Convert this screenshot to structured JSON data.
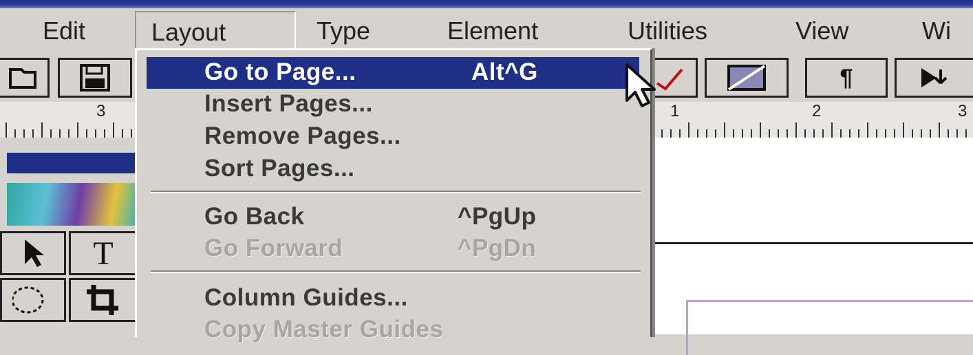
{
  "menubar": {
    "items": [
      "Edit",
      "Layout",
      "Type",
      "Element",
      "Utilities",
      "View",
      "Wi"
    ]
  },
  "toolbar": {
    "icons": [
      "open-icon",
      "save-icon",
      "spelling-icon",
      "fill-icon",
      "paragraph-icon",
      "play-icon"
    ],
    "paragraph_glyph": "¶"
  },
  "ruler": {
    "left_label": "3",
    "right_labels": [
      "1",
      "2",
      "3"
    ]
  },
  "toolbox": {
    "text_tool_glyph": "T",
    "icons": [
      "pointer-icon",
      "text-tool-icon",
      "ellipse-tool-icon",
      "crop-tool-icon"
    ]
  },
  "layout_menu": {
    "items": [
      {
        "label": "Go to Page...",
        "shortcut": "Alt^G",
        "state": "highlighted"
      },
      {
        "label": "Insert Pages...",
        "shortcut": "",
        "state": "normal"
      },
      {
        "label": "Remove Pages...",
        "shortcut": "",
        "state": "normal"
      },
      {
        "label": "Sort Pages...",
        "shortcut": "",
        "state": "normal"
      },
      {
        "label": "Go Back",
        "shortcut": "^PgUp",
        "state": "normal"
      },
      {
        "label": "Go Forward",
        "shortcut": "^PgDn",
        "state": "disabled"
      },
      {
        "label": "Column Guides...",
        "shortcut": "",
        "state": "normal"
      },
      {
        "label": "Copy Master Guides",
        "shortcut": "",
        "state": "disabled"
      }
    ]
  },
  "colors": {
    "highlight": "#1f2f86",
    "menu_bg": "#d6d3ce",
    "disabled_text": "#a9a6a0",
    "guide": "#c79ad0"
  }
}
